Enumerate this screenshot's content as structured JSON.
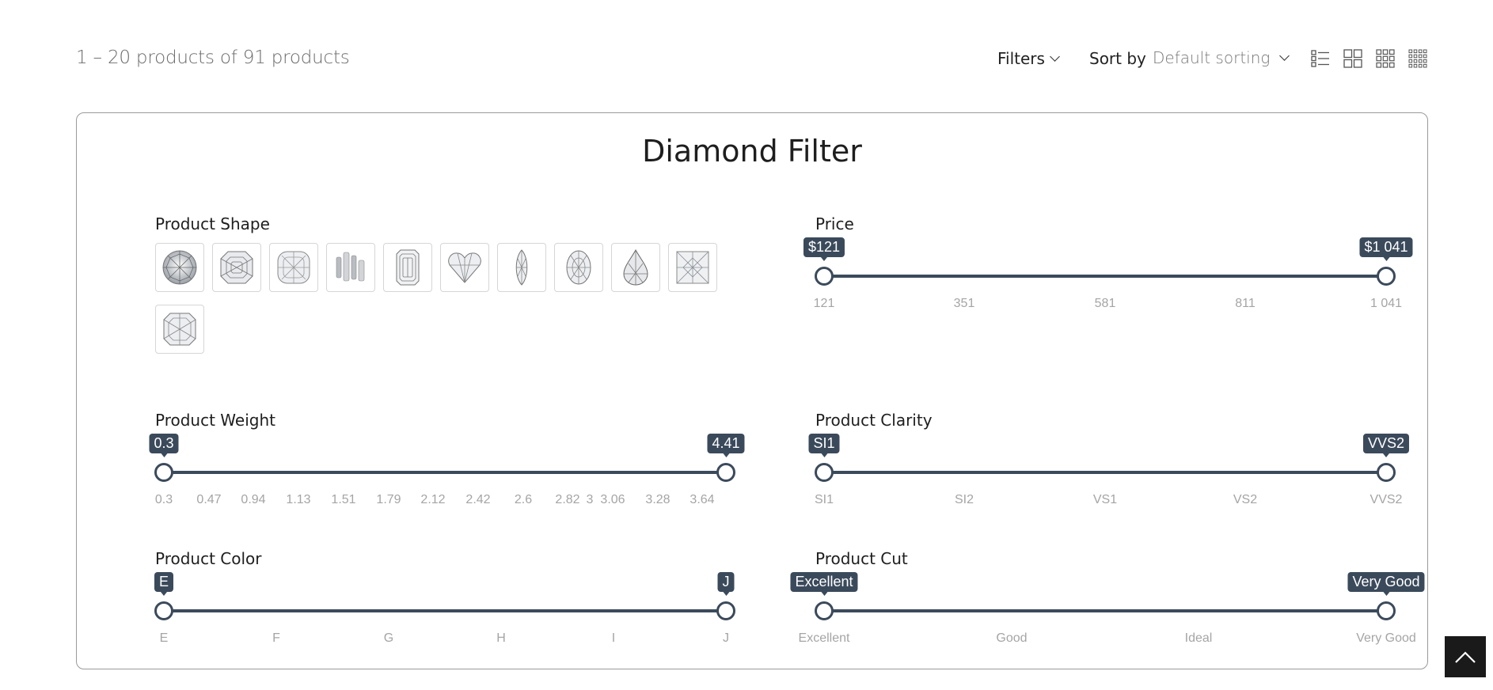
{
  "toolbar": {
    "result_count": "1 – 20 products of 91 products",
    "filters_label": "Filters",
    "sort_by_label": "Sort by",
    "sort_value": "Default sorting"
  },
  "filter": {
    "title": "Diamond Filter",
    "shape": {
      "label": "Product Shape",
      "options": [
        "round",
        "asscher",
        "cushion",
        "baguette",
        "emerald",
        "heart",
        "marquise",
        "oval",
        "pear",
        "princess",
        "radiant"
      ]
    },
    "price": {
      "label": "Price",
      "min_tip": "$121",
      "max_tip": "$1 041",
      "ticks": [
        "121",
        "351",
        "581",
        "811",
        "1 041"
      ]
    },
    "weight": {
      "label": "Product Weight",
      "min_tip": "0.3",
      "max_tip": "4.41",
      "ticks": [
        "0.3",
        "0.47",
        "0.94",
        "1.13",
        "1.51",
        "1.79",
        "2.12",
        "2.42",
        "2.6",
        "2.82",
        "3",
        "3.06",
        "3.28",
        "3.64"
      ]
    },
    "clarity": {
      "label": "Product Clarity",
      "min_tip": "SI1",
      "max_tip": "VVS2",
      "ticks": [
        "SI1",
        "SI2",
        "VS1",
        "VS2",
        "VVS2"
      ]
    },
    "color": {
      "label": "Product Color",
      "min_tip": "E",
      "max_tip": "J",
      "ticks": [
        "E",
        "F",
        "G",
        "H",
        "I",
        "J"
      ]
    },
    "cut": {
      "label": "Product Cut",
      "min_tip": "Excellent",
      "max_tip": "Very Good",
      "ticks": [
        "Excellent",
        "Good",
        "Ideal",
        "Very Good"
      ]
    }
  },
  "icons": {
    "view_list": "list-view-icon",
    "view_grid2": "grid-2-icon",
    "view_grid3": "grid-3-icon",
    "view_grid4": "grid-4-icon",
    "back_to_top": "chevron-up-icon"
  },
  "colors": {
    "slider": "#3b4a5b",
    "back_to_top": "#1a1a1a"
  }
}
